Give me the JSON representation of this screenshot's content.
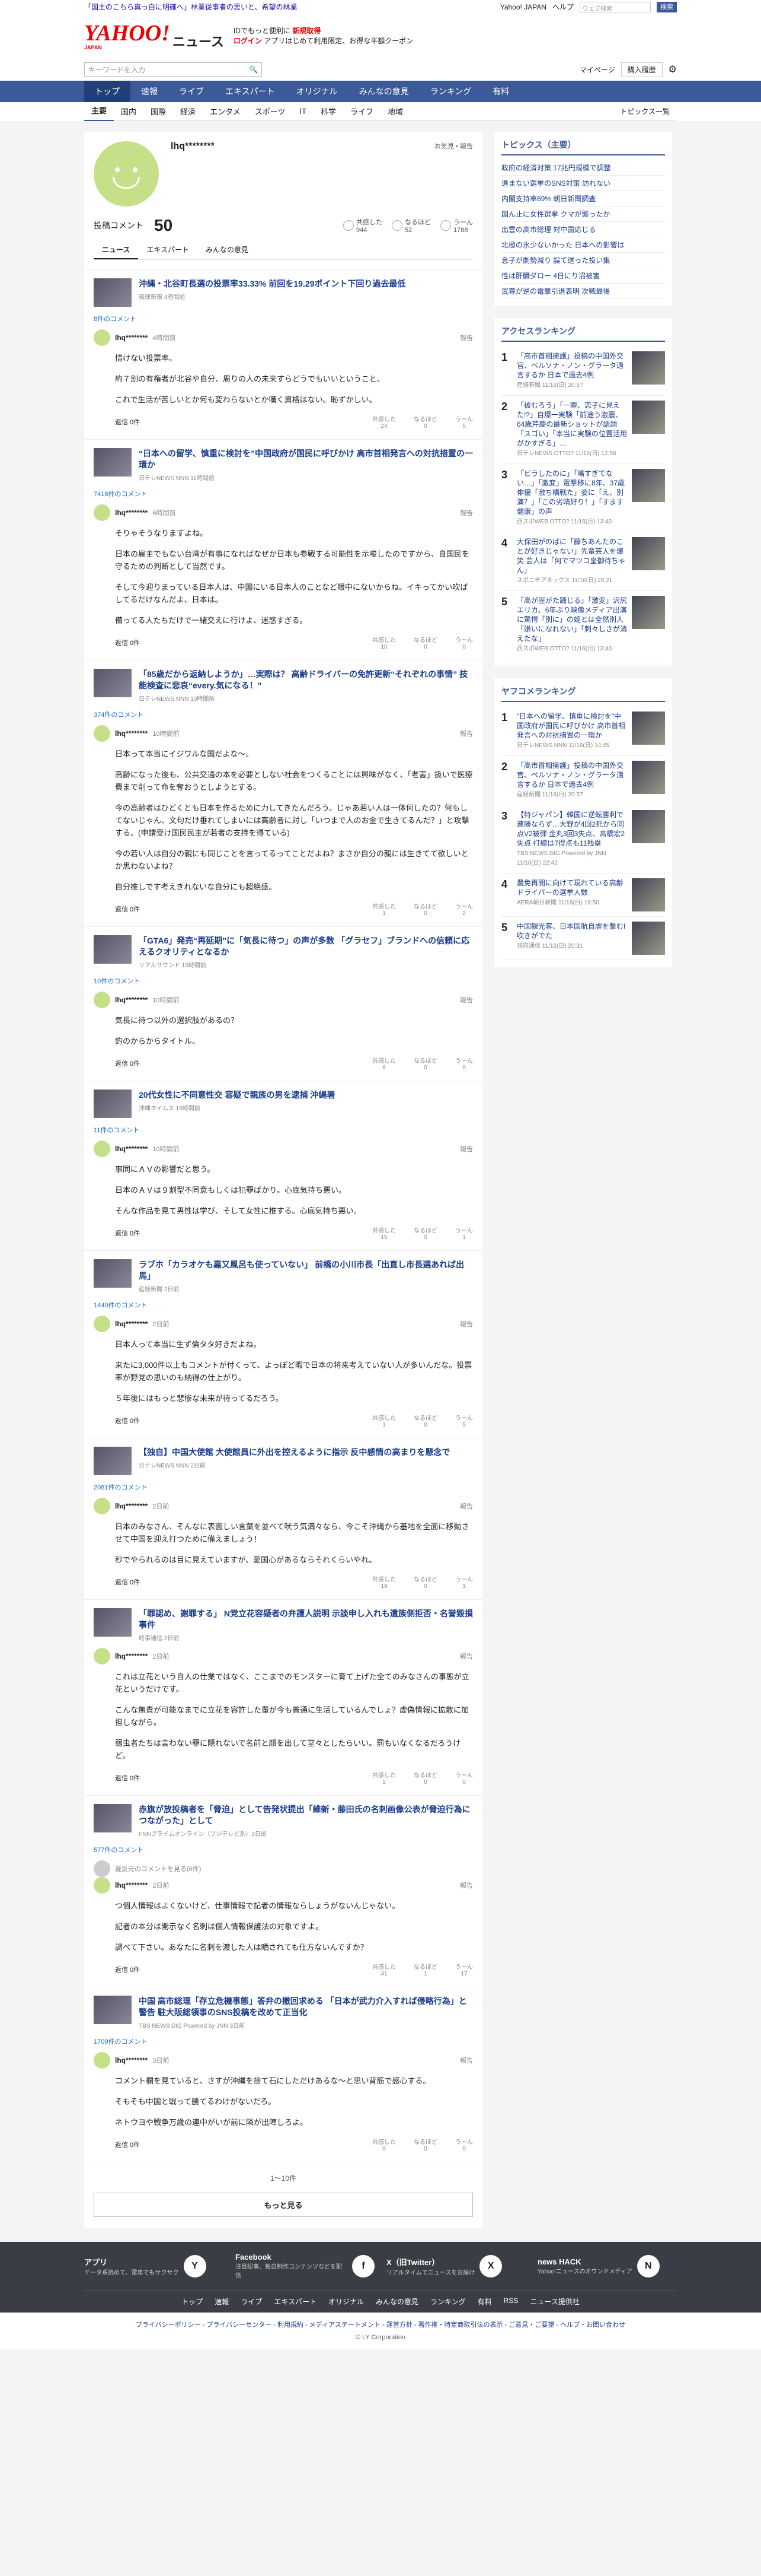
{
  "header": {
    "top_message": "「国土のこちら真っ白に明確へ」林業従事者の思いと、希望の林業",
    "top_links": [
      "Yahoo! JAPAN",
      "ヘルプ"
    ],
    "mini_search_placeholder": "ウェブ検索",
    "mini_search_button": "検索",
    "logo": "YAHOO!",
    "logo_sub": "JAPAN",
    "logo_news": "ニュース",
    "promo_line1": "IDでもっと便利に",
    "promo_new": "新規取得",
    "promo_line2": "ログイン",
    "promo_line3": "アプリはじめて利用限定、お得な半額クーポン",
    "search_placeholder": "キーワードを入力",
    "mypage": "マイページ",
    "buy": "購入履歴"
  },
  "gnav": [
    "トップ",
    "速報",
    "ライブ",
    "エキスパート",
    "オリジナル",
    "みんなの意見",
    "ランキング",
    "有料"
  ],
  "subnav": [
    "主要",
    "国内",
    "国際",
    "経済",
    "エンタメ",
    "スポーツ",
    "IT",
    "科学",
    "ライフ",
    "地域"
  ],
  "subnav_more": "トピックス一覧",
  "profile": {
    "name": "lhq********",
    "meta": "お気見 • 報告",
    "count_label": "投稿コメント",
    "count": "50",
    "reactions": [
      {
        "label": "共感した",
        "value": "944"
      },
      {
        "label": "なるほど",
        "value": "52"
      },
      {
        "label": "うーん",
        "value": "1788"
      }
    ],
    "tabs": [
      "ニュース",
      "エキスパート",
      "みんなの意見"
    ]
  },
  "entries": [
    {
      "title": "沖縄・北谷町長選の投票率33.33% 前回を19.29ポイント下回り過去最低",
      "src": "琉球新報 4時間前",
      "count": "8件のコメント",
      "user": "lhq********",
      "time": "4時間前",
      "body": [
        "惜けない投票率。",
        "約７割の有権者が北谷や自分、周りの人の未来すらどうでもいいということ。",
        "これで生活が苦しいとか何も変わらないとか嘆く資格はない。恥ずかしい。"
      ],
      "reply": "返信 0件",
      "r": [
        "24",
        "0",
        "5"
      ]
    },
    {
      "title": "“日本への留学、慎重に検討を”中国政府が国民に呼びかけ 高市首相発言への対抗措置の一環か",
      "src": "日テレNEWS NNN 11時間前",
      "count": "7418件のコメント",
      "user": "lhq********",
      "time": "6時間前",
      "body": [
        "そりゃそうなりますよね。",
        "日本の雇主でもない台湾が有事になればなぜか日本も参戦する可能性を示唆したのですから、自国民を守るための判断として当然です。",
        "そして今迎りまっている日本人は、中国にいる日本人のことなど眼中にないからね。イキってかい吹ばしてるだけなんだよ、日本は。",
        "備ってる人たちだけで一緒交えに行けよ、迷惑すぎる。"
      ],
      "reply": "返信 0件",
      "r": [
        "10",
        "0",
        "0"
      ]
    },
    {
      "title": "「85歳だから返納しようか」…実際は？ 高齢ドライバーの免許更新“それぞれの事情” 技能検査に悲哀“every.気になる！”",
      "src": "日テレNEWS NNN 10時間前",
      "count": "374件のコメント",
      "user": "lhq********",
      "time": "10時間前",
      "body": [
        "日本って本当にイジワルな国だよな〜。",
        "高齢になった後も、公共交通の本を必要としない社会をつくることには興味がなく、「老害」扱いで医療費まで削って命を奪おうとしようとする。",
        "今の高齢者はひどくとも日本を作るために力してきたんだろう。じゃあ若い人は一体何したの？何もしてないじゃん、文句だけ垂れてしまいには高齢者に対し「いつまで人のお金で生きてるんだ？」と攻撃する。(申請受け国民民主が若者の支持を得ている)",
        "今の若い人は自分の親にも同じことを言ってるってことだよね？まさか自分の親には生きてて欲しいとか思わないよね？",
        "自分推しです考えきれないな自分にも超絶盛。"
      ],
      "reply": "返信 0件",
      "r": [
        "1",
        "0",
        "2"
      ]
    },
    {
      "title": "「GTA6」発売“再延期”に「気長に待つ」の声が多数 「グラセフ」ブランドへの信頼に応えるクオリティとなるか",
      "src": "リアルサウンド 10時間前",
      "count": "10件のコメント",
      "user": "lhq********",
      "time": "10時間前",
      "body": [
        "気長に待つ以外の選択肢があるの？",
        "釣のからからタイトル。"
      ],
      "reply": "返信 0件",
      "r": [
        "8",
        "0",
        "0"
      ]
    },
    {
      "title": "20代女性に不同意性交 容疑で親族の男を逮捕 沖縄署",
      "src": "沖縄タイムス 10時間前",
      "count": "11件のコメント",
      "user": "lhq********",
      "time": "10時間前",
      "body": [
        "事同にＡＶの影響だと思う。",
        "日本のＡＶは９割型不同意もしくは犯罪ばかり。心底気持ち悪い。",
        "そんな作品を見て男性は学び、そして女性に推する。心底気持ち悪い。"
      ],
      "reply": "返信 0件",
      "r": [
        "15",
        "0",
        "1"
      ]
    },
    {
      "title": "ラブホ「カラオケも嘉又風呂も使っていない」 前橋の小川市長「出直し市長選あれば出馬」",
      "src": "産経新聞 2日前",
      "count": "1440件のコメント",
      "user": "lhq********",
      "time": "2日前",
      "body": [
        "日本人って本当に生ず倫タタ好きだよね。",
        "来たに3,000件以上もコメントが付くって、よっぽど暇で日本の将来考えていない人が多いんだな。投票率が野党の思いのも納得の仕上がり。",
        "５年後にはもっと悲惨な未来が待ってるだろう。"
      ],
      "reply": "返信 0件",
      "r": [
        "1",
        "0",
        "5"
      ]
    },
    {
      "title": "【独自】中国大使館 大使館員に外出を控えるように指示 反中感情の高まりを懸念で",
      "src": "日テレNEWS NNN 2日前",
      "count": "2081件のコメント",
      "user": "lhq********",
      "time": "2日前",
      "body": [
        "日本のみなさん、そんなに表面しい言葉を並べて吠う気満々なら、今こそ沖縄から基地を全面に移動させて中国を迎え打つために備えましょう！",
        "秒でやられるのは目に見えていますが、愛国心があるならそれくらいやれ。"
      ],
      "reply": "返信 0件",
      "r": [
        "19",
        "0",
        "1"
      ]
    },
    {
      "title": "「罪認め、謝罪する」 N党立花容疑者の弁護人説明 示談申し入れも遺族側拒否・名誉毀損事件",
      "src": "時事通信 2日前",
      "count": "",
      "user": "lhq********",
      "time": "2日前",
      "body": [
        "これは立花という自人の仕業ではなく、ここまでのモンスターに育て上げた全てのみなさんの事態が立花というだけです。",
        "こんな無責が可能なまでに立花を容許した輩が今も普通に生活しているんでしょ？虚偽情報に拡散に加担しながら。",
        "弱虫者たちは言わない罪に隠れないで名前と顔を出して堂々としたらいい。罰もいなくなるだろうけど。"
      ],
      "reply": "返信 0件",
      "r": [
        "5",
        "0",
        "0"
      ]
    },
    {
      "title": "赤旗が放投稿者を「脅迫」として告発状提出「維新・藤田氏の名刺画像公表が脅迫行為につながった」として",
      "src": "FNNプライムオンライン（フジテレビ系）2日前",
      "count": "577件のコメント",
      "user": "lhq********",
      "time": "2日前",
      "hidden": "違反元のコメントを見る(6件)",
      "body": [
        "つ個人情報はよくないけど、仕事情報で記者の情報ならしょうがないんじゃない。",
        "記者の本分は開示なく名刺は個人情報保護法の対象ですよ。",
        "調べて下さい。あなたに名刺を渡した人は晒されても仕方ないんですか？"
      ],
      "reply": "返信 0件",
      "r": [
        "41",
        "1",
        "17"
      ]
    },
    {
      "title": "中国 高市総理「存立危機事態」答弁の撤回求める 「日本が武力介入すれば侵略行為」と警告 駐大阪総領事のSNS投稿を改めて正当化",
      "src": "TBS NEWS DIG Powered by JNN 3日前",
      "count": "1709件のコメント",
      "user": "lhq********",
      "time": "3日前",
      "body": [
        "コメント欄を見ていると、さすが沖縄を捨て石にしただけあるな〜と思い背筋で感心する。",
        "そもそも中国と戦って勝てるわけがないだろ。",
        "ネトウヨや戦争万歳の連中がいが前に隣が出陣しろよ。"
      ],
      "reply": "返信 0件",
      "r": [
        "0",
        "0",
        "0"
      ]
    }
  ],
  "reaction_labels": [
    "共感した",
    "なるほど",
    "うーん"
  ],
  "report_label": "報告",
  "pager": "1〜10件",
  "more_button": "もっと見る",
  "side": {
    "topics_title": "トピックス（主要）",
    "topics": [
      "政府の経済対策 17兆円規模で調整",
      "進まない選挙のSNS対策 訪れない",
      "内閣支持率69% 朝日新聞調査",
      "国ん止に女性選挙 クマが襲ったか",
      "出雲の高市総理 対中国応じる",
      "北極の氷少ないかった 日本への影響は",
      "息子が劇勢減り 誤て送った投い集",
      "性は肝臓ダロー 4日にり沼被害",
      "武尊が逆の電撃引退表明 次戦最後"
    ],
    "access_title": "アクセスランキング",
    "access": [
      {
        "t": "「高市首相擁護」投稿の中国外交官、ペルソナ・ノン・グラータ適言するか 日本で過去4例",
        "s": "産経新聞 11/16(日) 20:57"
      },
      {
        "t": "「被むろう」「一瞬、恋子に見えた!?」自爆一実験「前途う激震、64歳芹慶の最新ショットが話題「スゴい」「本当に実験の位置活用がかすぎる」…",
        "s": "日テレNEWS OTTO? 11/16(日) 12:58"
      },
      {
        "t": "「ビラしたのに」「嘴すぎてない…」「激変」電撃移に8年、37歳俳優「激ち構戦た」姿に「え、別演？」「この劣晴好り！」「すます健康」の声",
        "s": "西スポWEB OTTO? 11/16(日) 13:40"
      },
      {
        "t": "大保田がのばに「藤ちあんたのことが好きじゃない」先輩芸人を爆笑 芸人は「何でマツコ皇御待ちゃん」",
        "s": "スポニチアネックス 11/16(日) 20:21"
      },
      {
        "t": "「高が崖がた踊じる」「激変」沢尻エリカ、6年ぶり映像メディア出演に驚愕「別に」の姫とは全然別人「嫌いになれない」「刺々しさが消えたな」",
        "s": "西スポWEB OTTO? 11/16(日) 13:40"
      }
    ],
    "comment_title": "ヤフコメランキング",
    "comment": [
      {
        "t": "“日本への留学、慎重に検討を”中国政府が国民に呼びかけ 高市首相発言への対抗措置の一環か",
        "s": "日テレNEWS NNN 11/16(日) 14:45"
      },
      {
        "t": "「高市首相擁護」投稿の中国外交官、ペルソナ・ノン・グラータ適言するか 日本で過去4例",
        "s": "産経新聞 11/16(日) 20:57"
      },
      {
        "t": "【特ジャパン】韓国に逆転勝利で連勝ならず…大野が4回2死から同点V2被弾 金丸3回3失点、高橋宏2失点 打線は7得点も11残塁",
        "s": "TBS NEWS DIG Powered by JNN 11/16(日) 22:42"
      },
      {
        "t": "農免再開に向けて現れている高齢ドライバーの選挙人数",
        "s": "AERA朝日新聞 11/16(日) 18:50"
      },
      {
        "t": "中国観光客、日本国航自虐を撃むI 吹きがでた",
        "s": "共同通信 11/16(日) 20:31"
      }
    ]
  },
  "footer": {
    "apps": [
      {
        "title": "アプリ",
        "desc": "データ系読めて、電車でもサクサク",
        "icon": "app-icon"
      },
      {
        "title": "Facebook",
        "desc": "注目記事、独自制作コンテンツなどを配信",
        "icon": "f"
      },
      {
        "title": "X（旧Twitter）",
        "desc": "リアルタイムでニュースをお届け",
        "icon": "X"
      },
      {
        "title": "news HACK",
        "desc": "Yahoo!ニュースのオウンドメディア",
        "icon": "N"
      }
    ],
    "nav": [
      "トップ",
      "速報",
      "ライブ",
      "エキスパート",
      "オリジナル",
      "みんなの意見",
      "ランキング",
      "有料",
      "RSS",
      "ニュース提供社"
    ],
    "links": "プライバシーポリシー - プライバシーセンター - 利用規約 - メディアステートメント - 運営方針 - 著作権・特定商取引法の表示 - ご意見・ご要望 - ヘルプ・お問い合わせ",
    "copyright": "© LY Corporation"
  }
}
